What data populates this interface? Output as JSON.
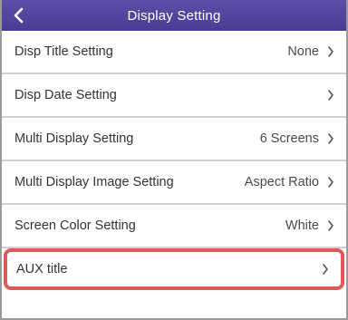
{
  "header": {
    "title": "Display Setting",
    "back_icon": "chevron-left-icon"
  },
  "rows": [
    {
      "label": "Disp Title Setting",
      "value": "None"
    },
    {
      "label": "Disp Date Setting",
      "value": ""
    },
    {
      "label": "Multi Display Setting",
      "value": "6 Screens"
    },
    {
      "label": "Multi Display Image Setting",
      "value": "Aspect Ratio"
    },
    {
      "label": "Screen Color Setting",
      "value": "White"
    },
    {
      "label": "AUX title",
      "value": ""
    }
  ],
  "colors": {
    "header_bg": "#4a3c93",
    "highlight_border": "#e05a5a"
  }
}
